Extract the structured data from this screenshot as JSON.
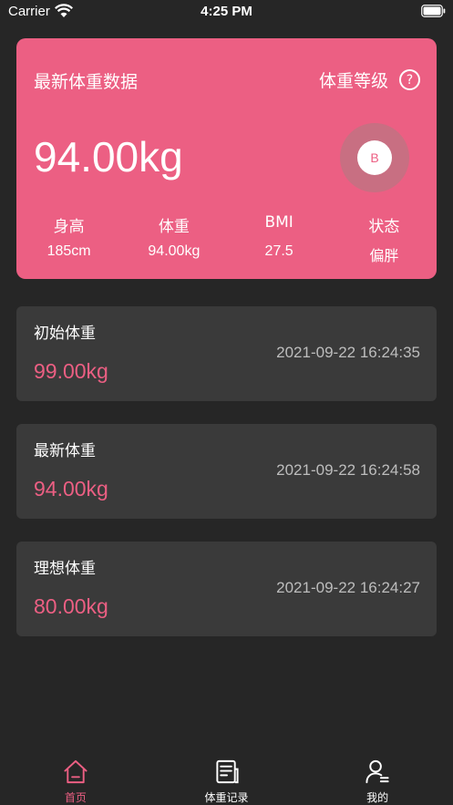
{
  "status_bar": {
    "carrier": "Carrier",
    "time": "4:25 PM"
  },
  "summary": {
    "title": "最新体重数据",
    "grade_label": "体重等级",
    "help_symbol": "?",
    "weight": "94.00kg",
    "grade": "B",
    "stats": [
      {
        "label": "身高",
        "value": "185cm"
      },
      {
        "label": "体重",
        "value": "94.00kg"
      },
      {
        "label": "BMI",
        "value": "27.5"
      },
      {
        "label": "状态",
        "value": "偏胖"
      }
    ]
  },
  "records": [
    {
      "label": "初始体重",
      "value": "99.00kg",
      "time": "2021-09-22 16:24:35"
    },
    {
      "label": "最新体重",
      "value": "94.00kg",
      "time": "2021-09-22 16:24:58"
    },
    {
      "label": "理想体重",
      "value": "80.00kg",
      "time": "2021-09-22 16:24:27"
    }
  ],
  "tabs": [
    {
      "label": "首页",
      "icon": "home-icon",
      "active": true
    },
    {
      "label": "体重记录",
      "icon": "document-icon",
      "active": false
    },
    {
      "label": "我的",
      "icon": "user-icon",
      "active": false
    }
  ],
  "colors": {
    "accent": "#ec5f83",
    "background": "#262626",
    "card": "#3a3a3a"
  }
}
